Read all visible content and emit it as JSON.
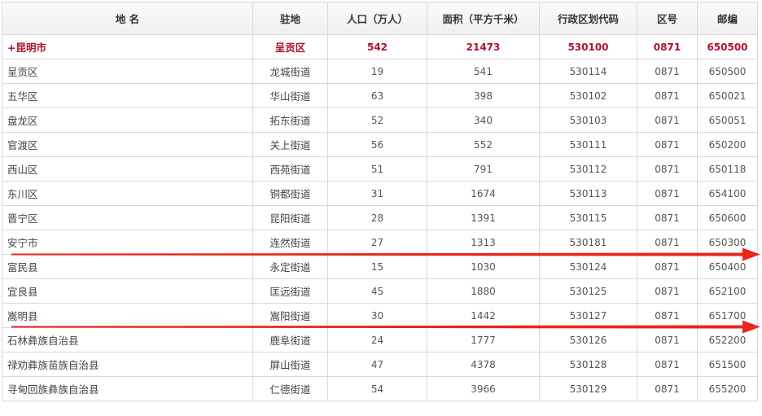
{
  "table": {
    "headers": [
      "地  名",
      "驻地",
      "人口（万人）",
      "面积（平方千米）",
      "行政区划代码",
      "区号",
      "邮编"
    ],
    "rows": [
      {
        "name": "+昆明市",
        "seat": "呈贡区",
        "pop": "542",
        "area": "21473",
        "code": "530100",
        "tel": "0871",
        "zip": "650500"
      },
      {
        "name": "呈贡区",
        "seat": "龙城街道",
        "pop": "19",
        "area": "541",
        "code": "530114",
        "tel": "0871",
        "zip": "650500"
      },
      {
        "name": "五华区",
        "seat": "华山街道",
        "pop": "63",
        "area": "398",
        "code": "530102",
        "tel": "0871",
        "zip": "650021"
      },
      {
        "name": "盘龙区",
        "seat": "拓东街道",
        "pop": "52",
        "area": "340",
        "code": "530103",
        "tel": "0871",
        "zip": "650051"
      },
      {
        "name": "官渡区",
        "seat": "关上街道",
        "pop": "56",
        "area": "552",
        "code": "530111",
        "tel": "0871",
        "zip": "650200"
      },
      {
        "name": "西山区",
        "seat": "西苑街道",
        "pop": "51",
        "area": "791",
        "code": "530112",
        "tel": "0871",
        "zip": "650118"
      },
      {
        "name": "东川区",
        "seat": "铜都街道",
        "pop": "31",
        "area": "1674",
        "code": "530113",
        "tel": "0871",
        "zip": "654100"
      },
      {
        "name": "晋宁区",
        "seat": "昆阳街道",
        "pop": "28",
        "area": "1391",
        "code": "530115",
        "tel": "0871",
        "zip": "650600"
      },
      {
        "name": "安宁市",
        "seat": "连然街道",
        "pop": "27",
        "area": "1313",
        "code": "530181",
        "tel": "0871",
        "zip": "650300"
      },
      {
        "name": "富民县",
        "seat": "永定街道",
        "pop": "15",
        "area": "1030",
        "code": "530124",
        "tel": "0871",
        "zip": "650400"
      },
      {
        "name": "宜良县",
        "seat": "匡远街道",
        "pop": "45",
        "area": "1880",
        "code": "530125",
        "tel": "0871",
        "zip": "652100"
      },
      {
        "name": "嵩明县",
        "seat": "嵩阳街道",
        "pop": "30",
        "area": "1442",
        "code": "530127",
        "tel": "0871",
        "zip": "651700"
      },
      {
        "name": "石林彝族自治县",
        "seat": "鹿阜街道",
        "pop": "24",
        "area": "1777",
        "code": "530126",
        "tel": "0871",
        "zip": "652200"
      },
      {
        "name": "禄劝彝族苗族自治县",
        "seat": "屏山街道",
        "pop": "47",
        "area": "4378",
        "code": "530128",
        "tel": "0871",
        "zip": "651500"
      },
      {
        "name": "寻甸回族彝族自治县",
        "seat": "仁德街道",
        "pop": "54",
        "area": "3966",
        "code": "530129",
        "tel": "0871",
        "zip": "655200"
      }
    ]
  },
  "colors": {
    "highlight_text": "#b0102a",
    "arrow": "#e8261c",
    "border": "#d9d9d9"
  },
  "annotations": [
    {
      "kind": "red-arrow",
      "below_row": "安宁市"
    },
    {
      "kind": "red-arrow",
      "below_row": "嵩明县"
    }
  ]
}
